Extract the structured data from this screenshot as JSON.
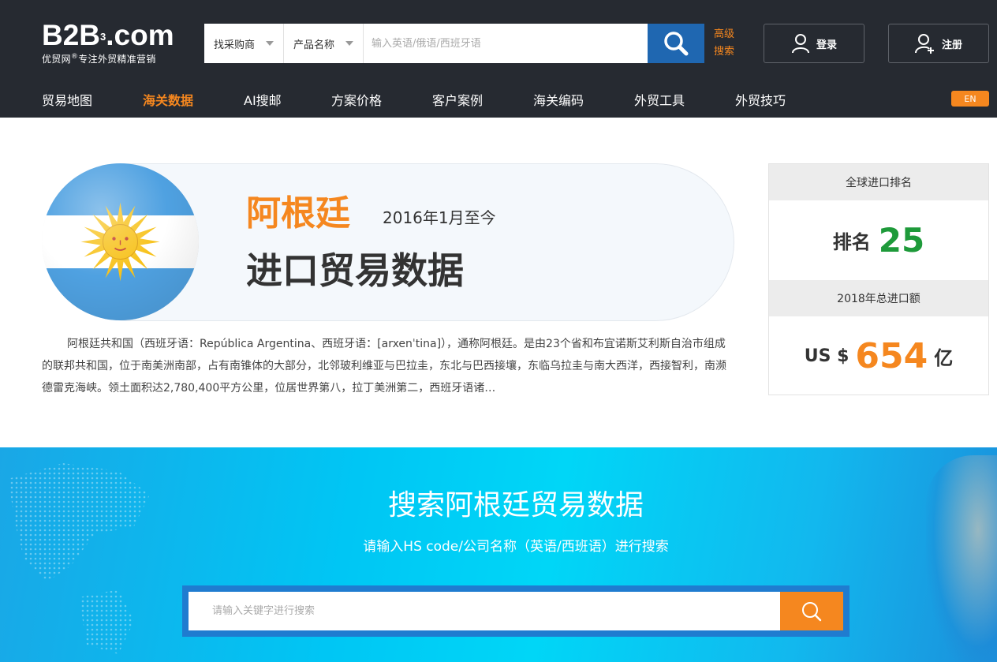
{
  "header": {
    "logo_main": "B2B",
    "logo_sup": "3",
    "logo_domain": ".com",
    "logo_sub": "优贸网",
    "logo_sub_reg": "®",
    "logo_sub_slogan": "专注外贸精准营销",
    "search": {
      "select_type": "找采购商",
      "select_field": "产品名称",
      "placeholder": "输入英语/俄语/西班牙语"
    },
    "advanced_search": "高级搜索",
    "login_label": "登录",
    "register_label": "注册",
    "en_label": "EN"
  },
  "nav": {
    "items": [
      {
        "label": "贸易地图"
      },
      {
        "label": "海关数据"
      },
      {
        "label": "AI搜邮"
      },
      {
        "label": "方案价格"
      },
      {
        "label": "客户案例"
      },
      {
        "label": "海关编码"
      },
      {
        "label": "外贸工具"
      },
      {
        "label": "外贸技巧"
      }
    ],
    "active": "海关数据"
  },
  "country": {
    "name": "阿根廷",
    "date_range": "2016年1月至今",
    "subtitle": "进口贸易数据",
    "description": "阿根廷共和国（西班牙语：República Argentina、西班牙语：[arxenˈtina]），通称阿根廷。是由23个省和布宜诺斯艾利斯自治市组成的联邦共和国，位于南美洲南部，占有南锥体的大部分，北邻玻利维亚与巴拉圭，东北与巴西接壤，东临乌拉圭与南大西洋，西接智利，南濒德雷克海峡。领土面积达2,780,400平方公里，位居世界第八，拉丁美洲第二，西班牙语诸…"
  },
  "rank_card": {
    "rank_title": "全球进口排名",
    "rank_label": "排名",
    "rank_value": "25",
    "total_title": "2018年总进口额",
    "currency": "US $",
    "total_value": "654",
    "unit": "亿"
  },
  "hero": {
    "title": "搜索阿根廷贸易数据",
    "subtitle": "请输入HS code/公司名称（英语/西班语）进行搜索",
    "placeholder": "请输入关键字进行搜索"
  },
  "colors": {
    "header_bg": "#262a31",
    "accent": "#f5871f",
    "search_button": "#1f67b1",
    "rank_green": "#1e9a3a"
  }
}
